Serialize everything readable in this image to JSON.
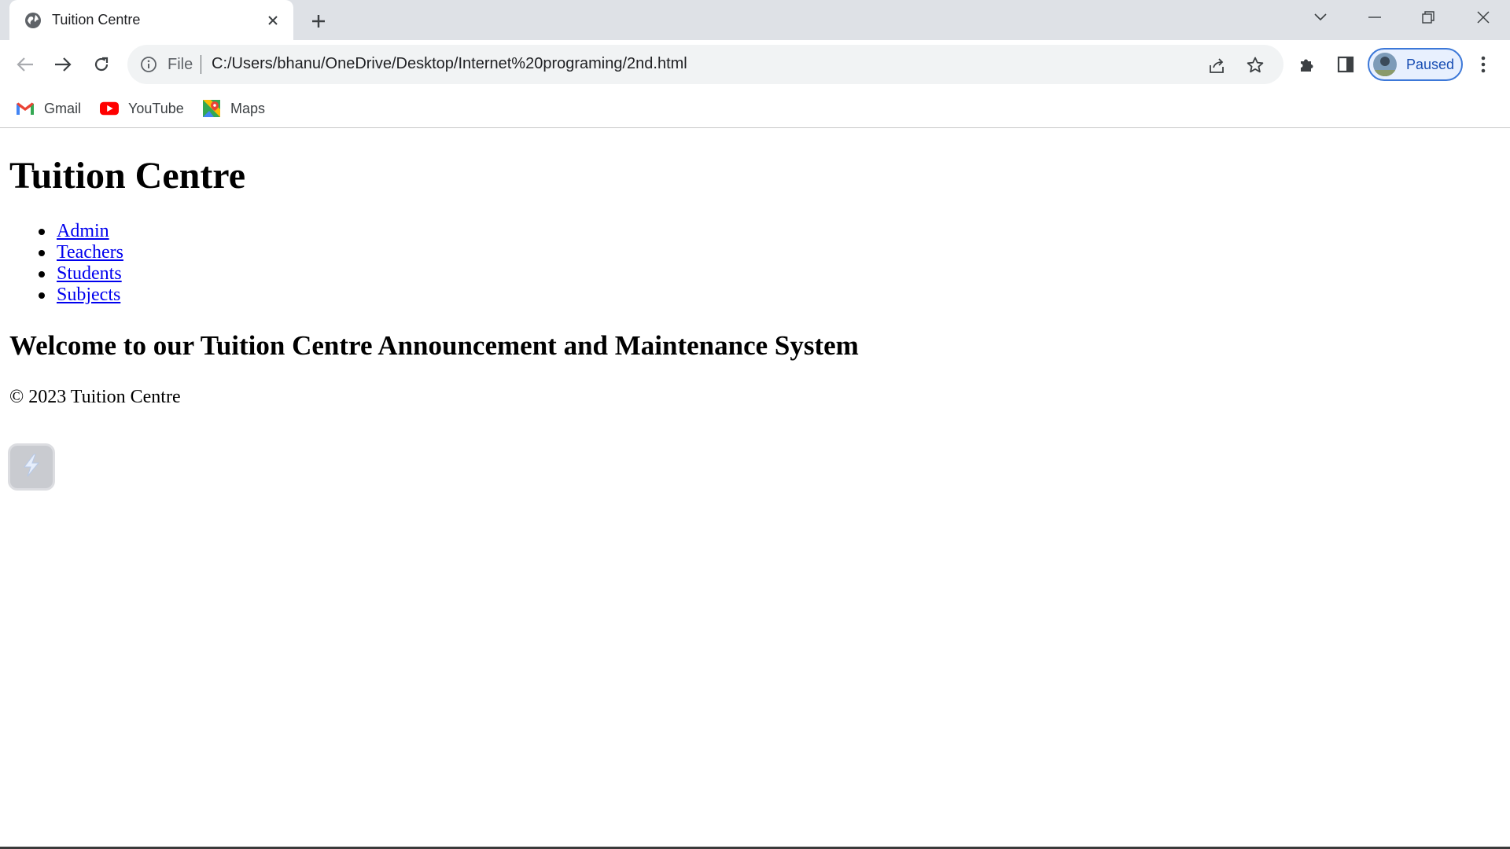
{
  "browser": {
    "tab": {
      "title": "Tuition Centre"
    },
    "toolbar": {
      "scheme_label": "File",
      "url": "C:/Users/bhanu/OneDrive/Desktop/Internet%20programing/2nd.html",
      "profile_label": "Paused"
    },
    "bookmarks": [
      {
        "label": "Gmail",
        "icon": "gmail-icon"
      },
      {
        "label": "YouTube",
        "icon": "youtube-icon"
      },
      {
        "label": "Maps",
        "icon": "maps-icon"
      }
    ],
    "colors": {
      "tabstrip": "#dee1e6",
      "omnibox": "#f1f3f4",
      "profile_border": "#3c78d8",
      "link": "#0000ee"
    }
  },
  "page": {
    "title": "Tuition Centre",
    "nav": [
      {
        "label": "Admin"
      },
      {
        "label": "Teachers"
      },
      {
        "label": "Students"
      },
      {
        "label": "Subjects"
      }
    ],
    "welcome": "Welcome to our Tuition Centre Announcement and Maintenance System",
    "footer": "© 2023 Tuition Centre"
  }
}
